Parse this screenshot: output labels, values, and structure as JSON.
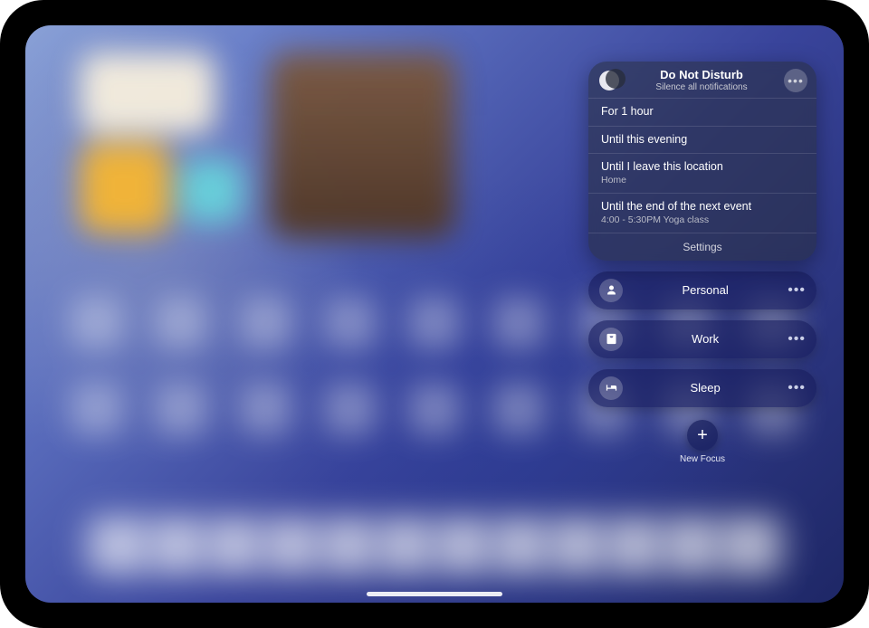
{
  "dnd": {
    "title": "Do Not Disturb",
    "subtitle": "Silence all notifications",
    "options": [
      {
        "label": "For 1 hour",
        "sub": ""
      },
      {
        "label": "Until this evening",
        "sub": ""
      },
      {
        "label": "Until I leave this location",
        "sub": "Home"
      },
      {
        "label": "Until the end of the next event",
        "sub": "4:00 - 5:30PM Yoga class"
      }
    ],
    "settings_label": "Settings"
  },
  "modes": [
    {
      "id": "personal",
      "label": "Personal"
    },
    {
      "id": "work",
      "label": "Work"
    },
    {
      "id": "sleep",
      "label": "Sleep"
    }
  ],
  "new_focus_label": "New Focus"
}
